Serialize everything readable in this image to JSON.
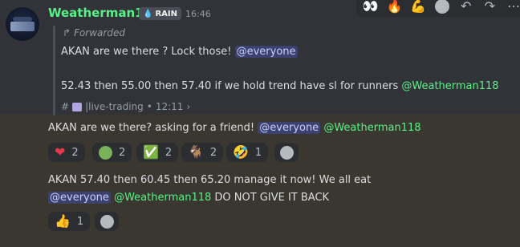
{
  "message": {
    "author": "Weatherman118",
    "role_tag": "RAIN",
    "time": "16:46"
  },
  "forward": {
    "label": "Forwarded",
    "line1_text": "AKAN are we there ? Lock those!",
    "line1_mention": "@everyone",
    "line2_text": "52.43 then 55.00 then 57.40 if we hold trend have sl for runners",
    "line2_mention": "@Weatherman118",
    "channel": "|live-trading",
    "channel_time": "12:11",
    "separator": "•",
    "chevron": "›"
  },
  "followup1": {
    "text": "AKAN are we there? asking for a friend!",
    "mention_everyone": "@everyone",
    "mention_user": "@Weatherman118"
  },
  "reactions1": [
    {
      "emoji": "❤",
      "icon": "heart-icon",
      "count": "2"
    },
    {
      "emoji": "",
      "icon": "green-circle-icon",
      "count": "2"
    },
    {
      "emoji": "✅",
      "icon": "check-mark-icon",
      "count": "2"
    },
    {
      "emoji": "🐐",
      "icon": "goat-icon",
      "count": "2"
    },
    {
      "emoji": "🤣",
      "icon": "rofl-icon",
      "count": "1"
    }
  ],
  "followup2": {
    "line1": "AKAN 57.40 then 60.45 then 65.20 manage it now! We all eat",
    "mention_everyone": "@everyone",
    "mention_user": "@Weatherman118",
    "tail": "DO NOT GIVE IT BACK"
  },
  "reactions2": [
    {
      "emoji": "👍",
      "icon": "thumbs-up-icon",
      "count": "1"
    }
  ],
  "toolbar": [
    "eyes-icon",
    "fire-icon",
    "flexed-biceps-icon",
    "add-reaction-icon",
    "reply-icon",
    "forward-icon",
    "more-icon"
  ],
  "colors": {
    "background": "#323339",
    "highlight": "#3a3630",
    "username": "#57f287",
    "mention_bg": "#3c4270"
  }
}
